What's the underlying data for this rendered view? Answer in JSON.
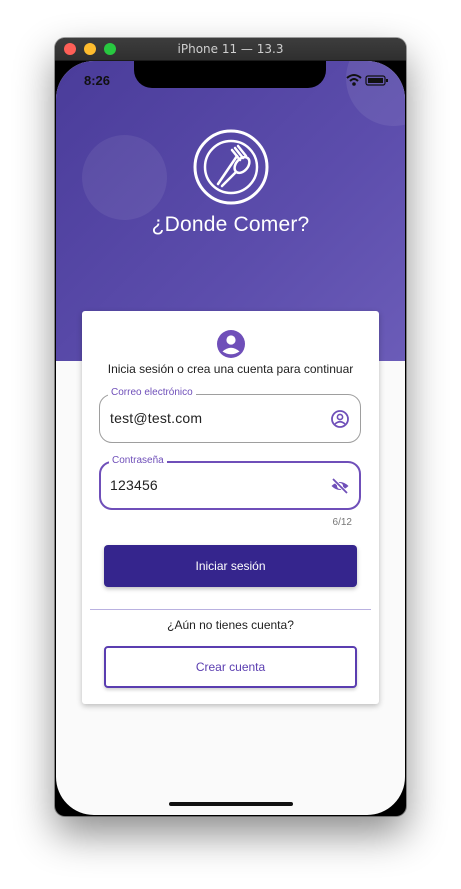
{
  "window": {
    "title": "iPhone 11 — 13.3"
  },
  "status_bar": {
    "time": "8:26",
    "icons": [
      "wifi-icon",
      "battery-icon"
    ]
  },
  "app": {
    "title": "¿Donde Comer?",
    "logo_icon": "utensils-plate-icon"
  },
  "card": {
    "avatar_icon": "account-circle-icon",
    "subtitle": "Inicia sesión o crea una cuenta para continuar",
    "email": {
      "label": "Correo electrónico",
      "value": "test@test.com",
      "icon": "account-circle-outline-icon"
    },
    "password": {
      "label": "Contraseña",
      "value": "123456",
      "icon": "visibility-off-icon",
      "counter": "6/12"
    },
    "login_button": "Iniciar sesión",
    "no_account_text": "¿Aún no tienes cuenta?",
    "create_button": "Crear cuenta"
  },
  "colors": {
    "hero_gradient_start": "#4a3c9a",
    "hero_gradient_end": "#6b5cb8",
    "primary_button": "#35258d",
    "accent": "#6f4fb9",
    "background": "#fafafa"
  }
}
